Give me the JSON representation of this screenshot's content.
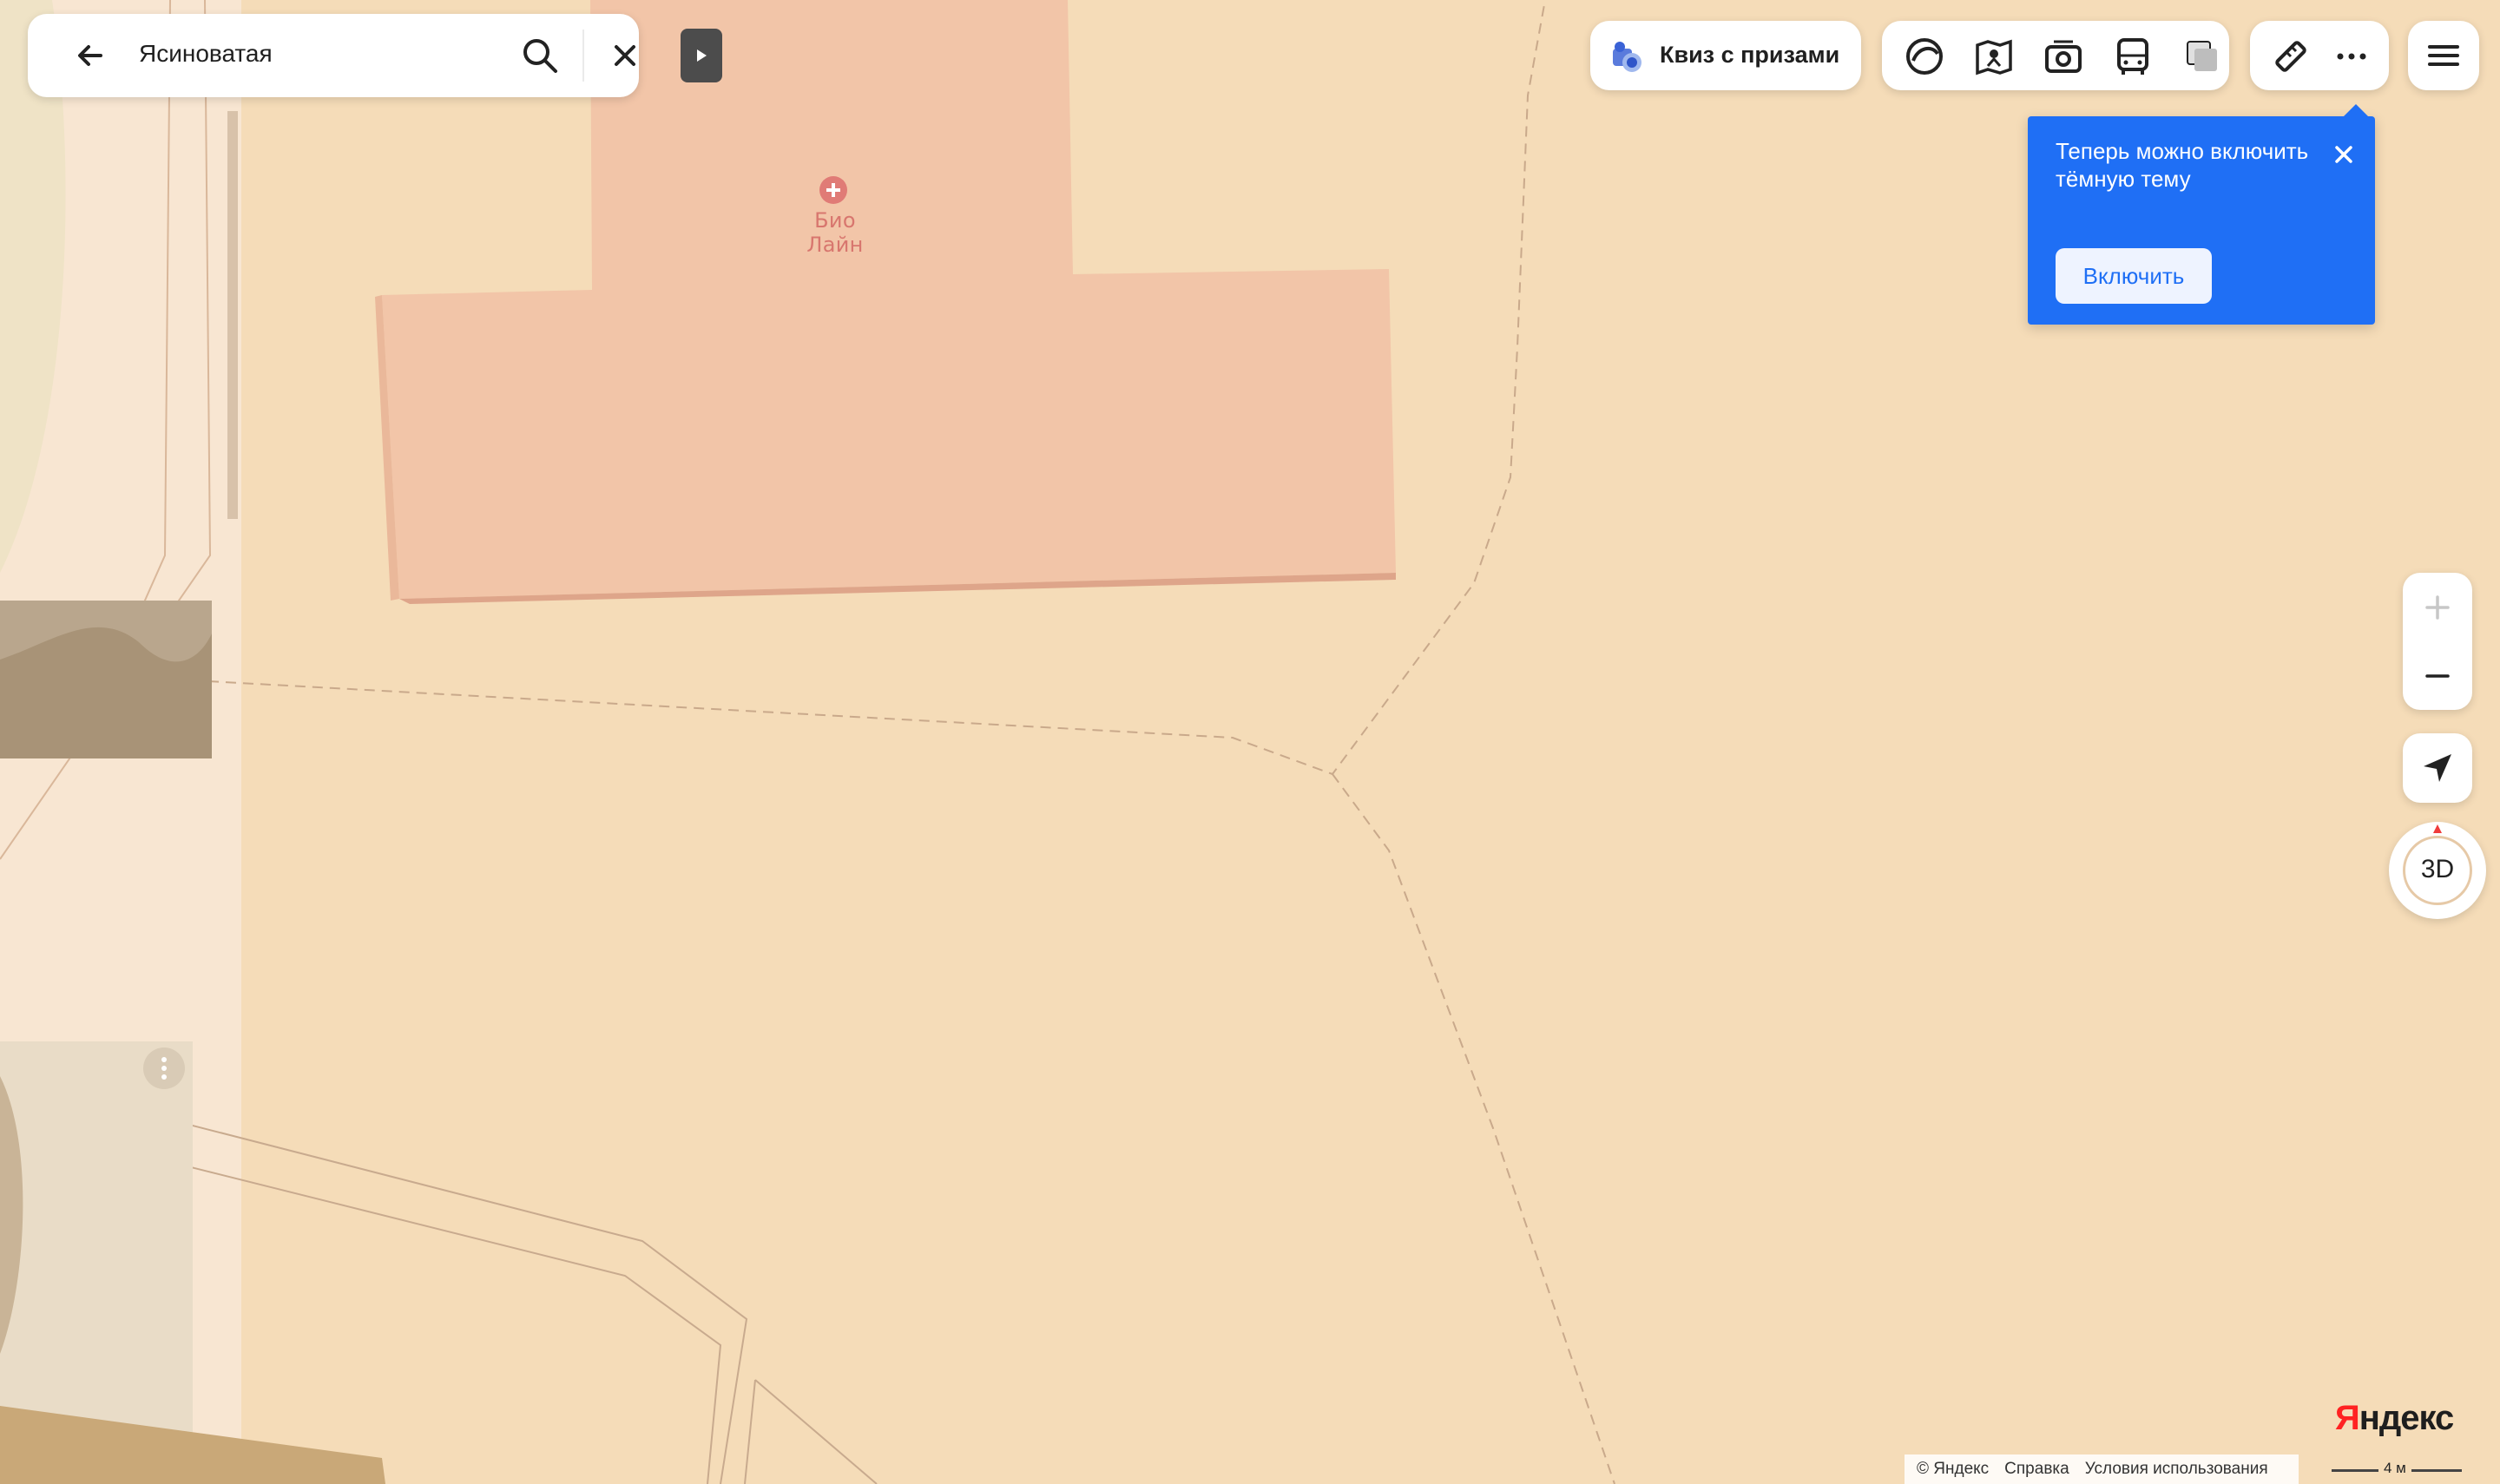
{
  "search": {
    "query": "Ясиноватая"
  },
  "map": {
    "poi_name": "Био Лайн"
  },
  "promo": {
    "quiz_label": "Квиз с призами"
  },
  "layers": {
    "buttons": [
      "alice-icon",
      "panorama-map-icon",
      "photo-icon",
      "transport-icon",
      "layers-icon"
    ]
  },
  "tools": {
    "buttons": [
      "ruler-icon",
      "more-icon"
    ]
  },
  "tooltip": {
    "text": "Теперь можно включить тёмную тему",
    "button": "Включить"
  },
  "controls": {
    "compass_label": "3D"
  },
  "footer": {
    "brand_first": "Я",
    "brand_rest": "ндекс",
    "copyright": "© Яндекс",
    "help": "Справка",
    "terms": "Условия использования",
    "scale": "4 м"
  },
  "colors": {
    "map_background": "#f5dcb8",
    "building": "#f2c5a8",
    "accent_blue": "#1f6ff5",
    "poi_red": "#e07b76"
  }
}
